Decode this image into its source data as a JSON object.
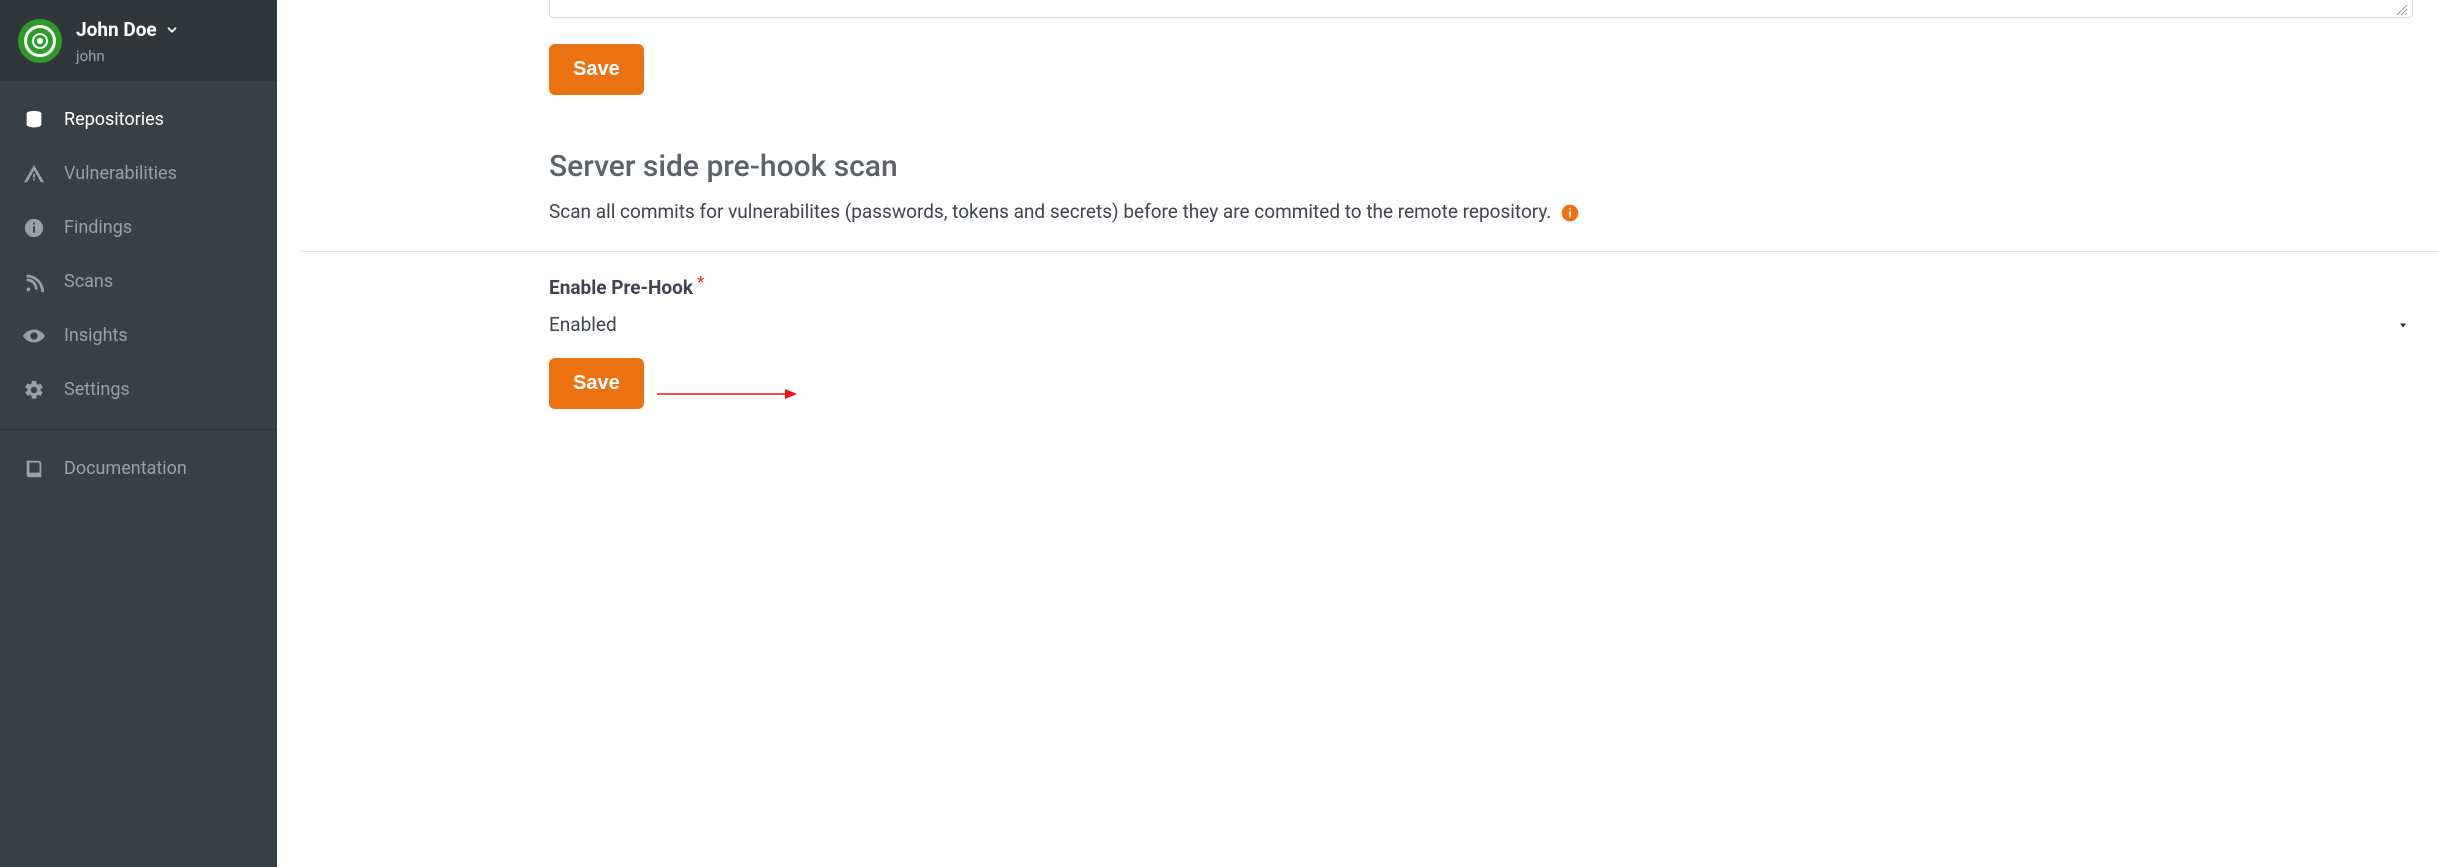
{
  "user": {
    "display_name": "John Doe",
    "username": "john"
  },
  "sidebar": {
    "items": [
      {
        "key": "repositories",
        "label": "Repositories",
        "icon": "database-icon",
        "active": true
      },
      {
        "key": "vulnerabilities",
        "label": "Vulnerabilities",
        "icon": "warning-icon"
      },
      {
        "key": "findings",
        "label": "Findings",
        "icon": "info-icon"
      },
      {
        "key": "scans",
        "label": "Scans",
        "icon": "rss-icon"
      },
      {
        "key": "insights",
        "label": "Insights",
        "icon": "eye-icon"
      },
      {
        "key": "settings",
        "label": "Settings",
        "icon": "gear-icon"
      }
    ],
    "footer": [
      {
        "key": "documentation",
        "label": "Documentation",
        "icon": "book-icon"
      }
    ]
  },
  "form_top": {
    "save_label": "Save"
  },
  "prehook": {
    "heading": "Server side pre-hook scan",
    "description": "Scan all commits for vulnerabilites (passwords, tokens and secrets) before they are commited to the remote repository.",
    "field_label": "Enable Pre-Hook",
    "required_marker": "*",
    "value": "Enabled",
    "save_label": "Save"
  },
  "colors": {
    "accent": "#ec7211",
    "sidebar_bg": "#3a3f44",
    "required": "#e03e2d"
  }
}
